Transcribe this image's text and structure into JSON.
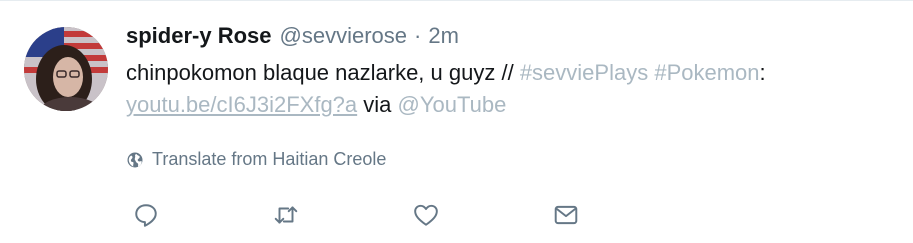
{
  "tweet": {
    "display_name": "spider-y Rose",
    "handle": "@sevvierose",
    "separator": "·",
    "time": "2m",
    "text_part1": "chinpokomon blaque nazlarke, u guyz // ",
    "hashtag1": "#sevviePlays",
    "text_space": " ",
    "hashtag2": "#Pokemon",
    "text_colon": ":",
    "link": "youtu.be/cI6J3i2FXfg?a",
    "via": " via ",
    "mention": "@YouTube",
    "translate_label": "Translate from Haitian Creole"
  },
  "colors": {
    "text": "#14171a",
    "muted": "#657786",
    "link_faded": "#aab8c2"
  },
  "icons": {
    "translate": "globe-icon",
    "reply": "reply-icon",
    "retweet": "retweet-icon",
    "like": "heart-icon",
    "dm": "envelope-icon"
  }
}
